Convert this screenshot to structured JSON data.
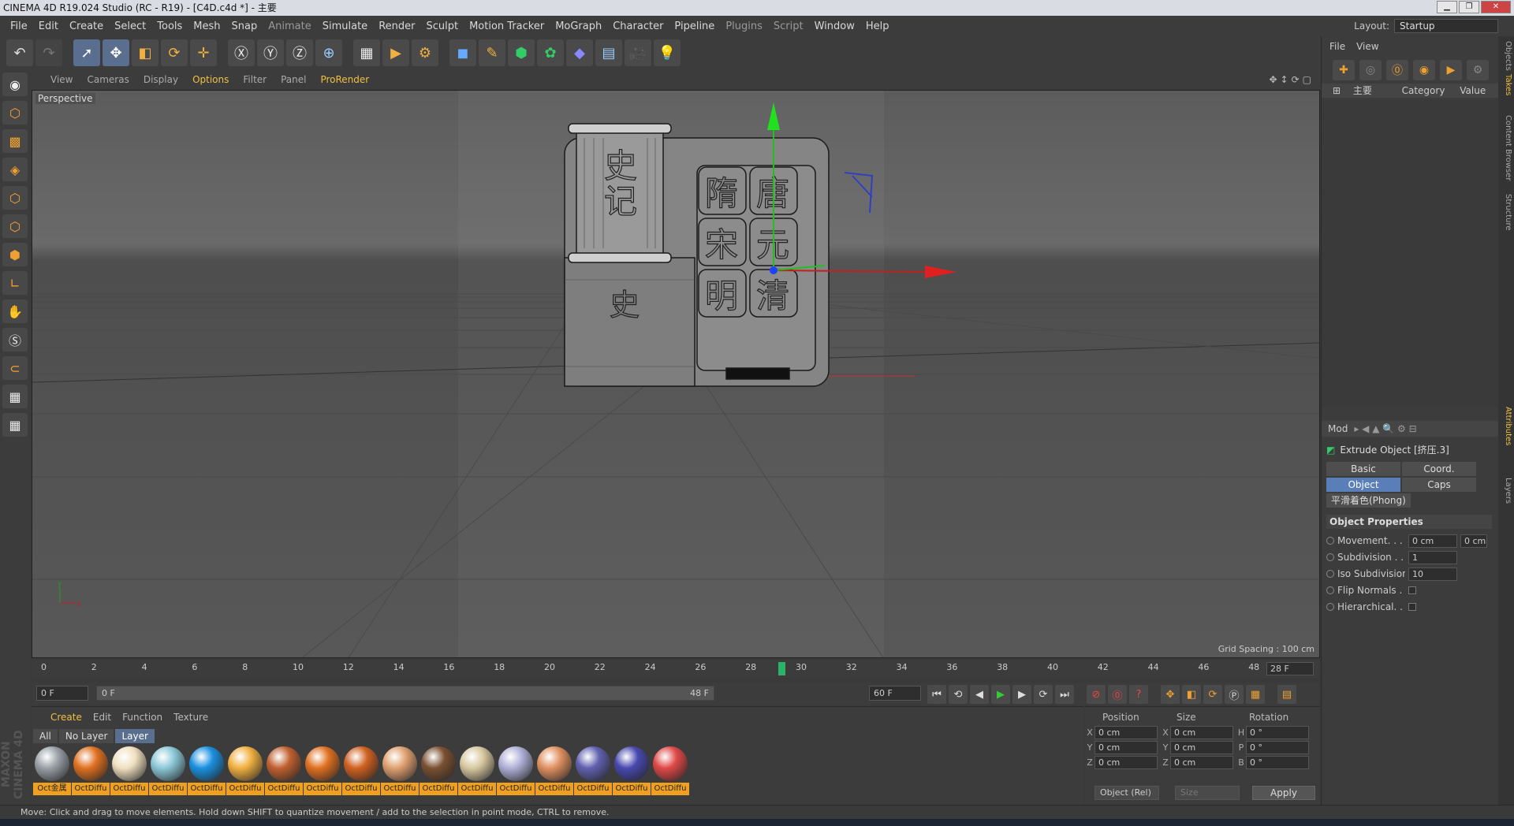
{
  "window": {
    "title": "CINEMA 4D R19.024 Studio (RC - R19) - [C4D.c4d *] - 主要"
  },
  "menu": [
    "File",
    "Edit",
    "Create",
    "Select",
    "Tools",
    "Mesh",
    "Snap",
    "Animate",
    "Simulate",
    "Render",
    "Sculpt",
    "Motion Tracker",
    "MoGraph",
    "Character",
    "Pipeline",
    "Plugins",
    "Script",
    "Window",
    "Help"
  ],
  "layout": {
    "label": "Layout:",
    "value": "Startup"
  },
  "viewport_menu": [
    "View",
    "Cameras",
    "Display",
    "Options",
    "Filter",
    "Panel",
    "ProRender"
  ],
  "viewport": {
    "name": "Perspective",
    "grid_spacing": "Grid Spacing : 100 cm",
    "chars": [
      "史",
      "记",
      "隋",
      "唐",
      "宋",
      "元",
      "明",
      "清",
      "史"
    ]
  },
  "timeline": {
    "ticks": [
      "0",
      "2",
      "4",
      "6",
      "8",
      "10",
      "12",
      "14",
      "16",
      "18",
      "20",
      "22",
      "24",
      "26",
      "28",
      "30",
      "32",
      "34",
      "36",
      "38",
      "40",
      "42",
      "44",
      "46",
      "48"
    ],
    "current": "28 F"
  },
  "transport": {
    "start": "0 F",
    "range_start": "0 F",
    "range_end": "48 F",
    "end": "60 F"
  },
  "materials": {
    "menu": [
      "Create",
      "Edit",
      "Function",
      "Texture"
    ],
    "tabs": [
      "All",
      "No Layer",
      "Layer"
    ],
    "items": [
      {
        "label": "Oct金属",
        "color": "#9aa0a8"
      },
      {
        "label": "OctDiffu",
        "color": "#e07020"
      },
      {
        "label": "OctDiffu",
        "color": "#f0e0c0"
      },
      {
        "label": "OctDiffu",
        "color": "#8cc8d8"
      },
      {
        "label": "OctDiffu",
        "color": "#1a90e0"
      },
      {
        "label": "OctDiffu",
        "color": "#f0b040"
      },
      {
        "label": "OctDiffu",
        "color": "#c06030"
      },
      {
        "label": "OctDiffu",
        "color": "#e07020"
      },
      {
        "label": "OctDiffu",
        "color": "#d06020"
      },
      {
        "label": "OctDiffu",
        "color": "#e0a070"
      },
      {
        "label": "OctDiffu",
        "color": "#7a5030"
      },
      {
        "label": "OctDiffu",
        "color": "#d8c8a0"
      },
      {
        "label": "OctDiffu",
        "color": "#b0b0d8"
      },
      {
        "label": "OctDiffu",
        "color": "#e09060"
      },
      {
        "label": "OctDiffu",
        "color": "#6060b0"
      },
      {
        "label": "OctDiffu",
        "color": "#4848b0"
      },
      {
        "label": "OctDiffu",
        "color": "#e04848"
      }
    ]
  },
  "coords": {
    "headers": [
      "Position",
      "Size",
      "Rotation"
    ],
    "rows": [
      {
        "a": "X",
        "pos": "0 cm",
        "b": "X",
        "size": "0 cm",
        "c": "H",
        "rot": "0 °"
      },
      {
        "a": "Y",
        "pos": "0 cm",
        "b": "Y",
        "size": "0 cm",
        "c": "P",
        "rot": "0 °"
      },
      {
        "a": "Z",
        "pos": "0 cm",
        "b": "Z",
        "size": "0 cm",
        "c": "B",
        "rot": "0 °"
      }
    ],
    "mode": "Object (Rel)",
    "size_mode": "Size",
    "apply": "Apply"
  },
  "objects_panel": {
    "menu": [
      "File",
      "View"
    ],
    "col_name": "主要",
    "col_category": "Category",
    "col_value": "Value"
  },
  "attributes": {
    "mode": "Mod",
    "object_title": "Extrude Object [挤压.3]",
    "tabs": [
      "Basic",
      "Coord.",
      "Object",
      "Caps"
    ],
    "phong": "平滑着色(Phong)",
    "section": "Object Properties",
    "rows": [
      {
        "label": "Movement. . . .",
        "value": "0 cm",
        "extra": "0 cm"
      },
      {
        "label": "Subdivision . .",
        "value": "1"
      },
      {
        "label": "Iso Subdivision",
        "value": "10"
      },
      {
        "label": "Flip Normals . ."
      },
      {
        "label": "Hierarchical. . ."
      }
    ]
  },
  "right_tabs": [
    "Objects",
    "Takes",
    "Content Browser",
    "Structure",
    "Attributes",
    "Layers"
  ],
  "status": "Move: Click and drag to move elements. Hold down SHIFT to quantize movement / add to the selection in point mode, CTRL to remove.",
  "brand": "MAXON CINEMA 4D"
}
